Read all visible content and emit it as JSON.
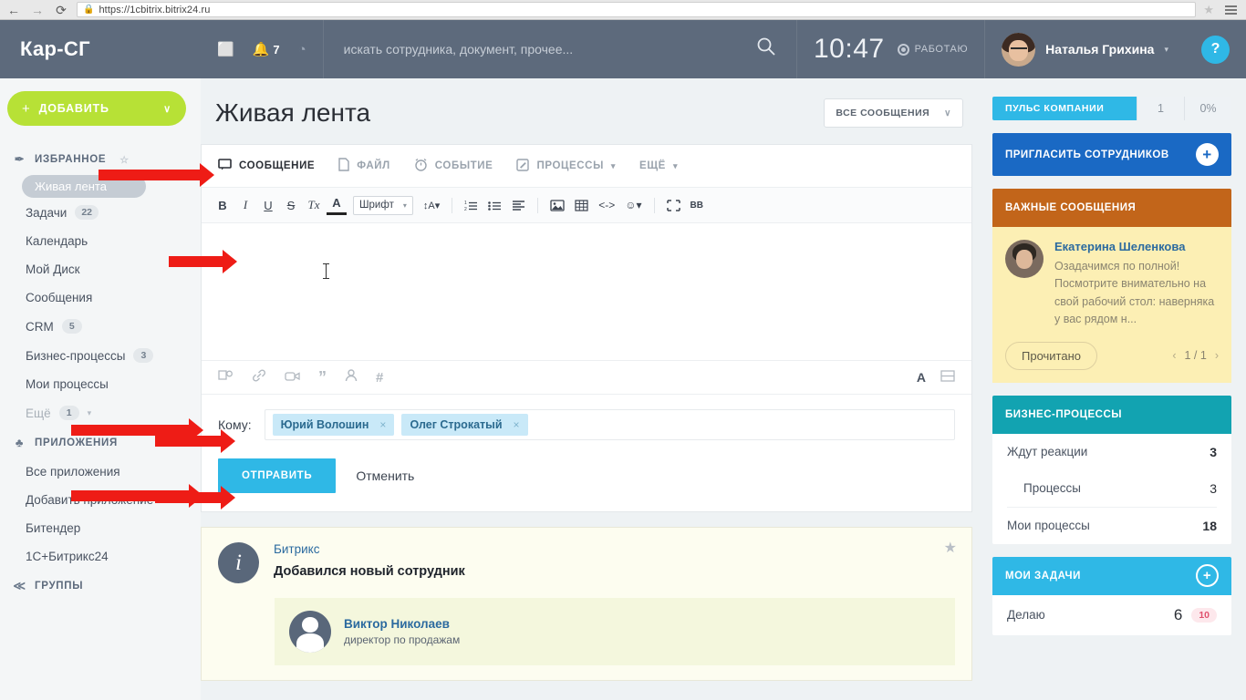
{
  "browser": {
    "url": "https://1cbitrix.bitrix24.ru",
    "back_icon": "←",
    "forward_icon": "→",
    "reload_icon": "⟳",
    "lock_icon": "🔒",
    "star_icon": "★"
  },
  "header": {
    "logo": "Кар-СГ",
    "chat_icon": "⬜",
    "bell_icon": "🔔",
    "notification_count": "7",
    "cloud_icon": "◔",
    "search_placeholder": "искать сотрудника, документ, прочее...",
    "search_icon": "🔍",
    "clock": "10:47",
    "status": "РАБОТАЮ",
    "user_name": "Наталья Грихина",
    "caret": "▾",
    "help": "?"
  },
  "sidebar": {
    "add_button": "ДОБАВИТЬ",
    "add_plus": "+",
    "add_caret": "∨",
    "sections": [
      {
        "label": "ИЗБРАННОЕ",
        "icon": "✒",
        "pin": "☆"
      },
      {
        "label": "ПРИЛОЖЕНИЯ",
        "icon": "♣"
      },
      {
        "label": "ГРУППЫ",
        "icon": "≪"
      }
    ],
    "favorites": [
      {
        "label": "Живая лента",
        "badge": "",
        "active": true
      },
      {
        "label": "Задачи",
        "badge": "22"
      },
      {
        "label": "Календарь",
        "badge": ""
      },
      {
        "label": "Мой Диск",
        "badge": ""
      },
      {
        "label": "Сообщения",
        "badge": ""
      },
      {
        "label": "CRM",
        "badge": "5"
      },
      {
        "label": "Бизнес-процессы",
        "badge": "3"
      },
      {
        "label": "Мои процессы",
        "badge": ""
      },
      {
        "label": "Ещё",
        "badge": "1",
        "caret": "▾"
      }
    ],
    "apps": [
      {
        "label": "Все приложения"
      },
      {
        "label": "Добавить приложение"
      },
      {
        "label": "Битендер"
      },
      {
        "label": "1С+Битрикс24"
      }
    ]
  },
  "main": {
    "page_title": "Живая лента",
    "filter_label": "ВСЕ СООБЩЕНИЯ",
    "filter_caret": "∨",
    "form_tabs": [
      {
        "label": "СООБЩЕНИЕ",
        "icon": "🗪",
        "active": true
      },
      {
        "label": "ФАЙЛ",
        "icon": "🗋",
        "active": false
      },
      {
        "label": "СОБЫТИЕ",
        "icon": "⏰",
        "active": false
      },
      {
        "label": "ПРОЦЕССЫ",
        "icon": "🗊",
        "active": false,
        "caret": "▾"
      },
      {
        "label": "ЕЩЁ",
        "icon": "",
        "active": false,
        "caret": "▾"
      }
    ],
    "rte_tools": [
      {
        "name": "bold",
        "glyph": "B",
        "style": "font-weight:bold"
      },
      {
        "name": "italic",
        "glyph": "I",
        "style": "font-style:italic;font-family:\"Liberation Serif\",serif"
      },
      {
        "name": "underline",
        "glyph": "U",
        "style": "text-decoration:underline"
      },
      {
        "name": "strikethrough",
        "glyph": "S",
        "style": "text-decoration:line-through"
      },
      {
        "name": "clear-format",
        "glyph": "Tx",
        "style": "font-style:italic;font-family:\"Liberation Serif\",serif"
      },
      {
        "name": "text-color",
        "glyph": "A",
        "style": "border-bottom:3px solid #222;line-height:1"
      }
    ],
    "font_select": "Шрифт",
    "font_caret": "▾",
    "font_size_tool": "↕A▾",
    "rte_tools2": [
      {
        "name": "ordered-list",
        "glyph": "≣"
      },
      {
        "name": "bullet-list",
        "glyph": "☰"
      },
      {
        "name": "align",
        "glyph": "≡"
      },
      {
        "name": "insert-image",
        "glyph": "🖼"
      },
      {
        "name": "insert-table",
        "glyph": "▦"
      },
      {
        "name": "source-code",
        "glyph": "<->"
      },
      {
        "name": "emoji",
        "glyph": "☺▾"
      },
      {
        "name": "fullscreen",
        "glyph": "⛶"
      },
      {
        "name": "bb-code",
        "glyph": "BB"
      }
    ],
    "attach_tools": [
      {
        "name": "attach-file",
        "glyph": "🖶"
      },
      {
        "name": "insert-link",
        "glyph": "🔗"
      },
      {
        "name": "record-video",
        "glyph": "📹"
      },
      {
        "name": "quote",
        "glyph": "”"
      },
      {
        "name": "mention-user",
        "glyph": "♿"
      },
      {
        "name": "hashtag",
        "glyph": "#"
      }
    ],
    "attach_right": [
      {
        "name": "text-format",
        "glyph": "A"
      },
      {
        "name": "view-toggle",
        "glyph": "⌸"
      }
    ],
    "to_label": "Кому:",
    "recipients": [
      {
        "name": "Юрий Волошин",
        "remove": "×"
      },
      {
        "name": "Олег Строкатый",
        "remove": "×"
      }
    ],
    "send_label": "ОТПРАВИТЬ",
    "cancel_label": "Отменить",
    "feed_post": {
      "author": "Битрикс",
      "title": "Добавился новый сотрудник",
      "star": "★",
      "info_icon": "i",
      "employee_name": "Виктор Николаев",
      "employee_role": "директор по продажам"
    }
  },
  "right": {
    "pulse": {
      "label": "ПУЛЬС КОМПАНИИ",
      "value": "1",
      "percent": "0%"
    },
    "invite": {
      "label": "ПРИГЛАСИТЬ СОТРУДНИКОВ",
      "plus": "+"
    },
    "important": {
      "title": "ВАЖНЫЕ СООБЩЕНИЯ",
      "author": "Екатерина Шеленкова",
      "text": "Озадачимся по полной! Посмотрите внимательно на свой рабочий стол: наверняка у вас рядом н...",
      "read_button": "Прочитано",
      "pager": "1 / 1",
      "prev": "‹",
      "next": "›"
    },
    "processes": {
      "title": "БИЗНЕС-ПРОЦЕССЫ",
      "rows": [
        {
          "label": "Ждут реакции",
          "value": "3",
          "indent": false,
          "bold": true
        },
        {
          "label": "Процессы",
          "value": "3",
          "indent": true,
          "bold": false
        },
        {
          "label": "Мои процессы",
          "value": "18",
          "indent": false,
          "bold": true
        }
      ]
    },
    "tasks": {
      "title": "МОИ ЗАДАЧИ",
      "plus": "+",
      "rows": [
        {
          "label": "Делаю",
          "value": "6",
          "pill": "10"
        }
      ]
    }
  },
  "annotations": {
    "arrow_color": "#ee1c16",
    "targets": [
      "message-tab",
      "editor-area",
      "recipients-field",
      "send-button",
      "my-processes",
      "applications-section"
    ]
  }
}
